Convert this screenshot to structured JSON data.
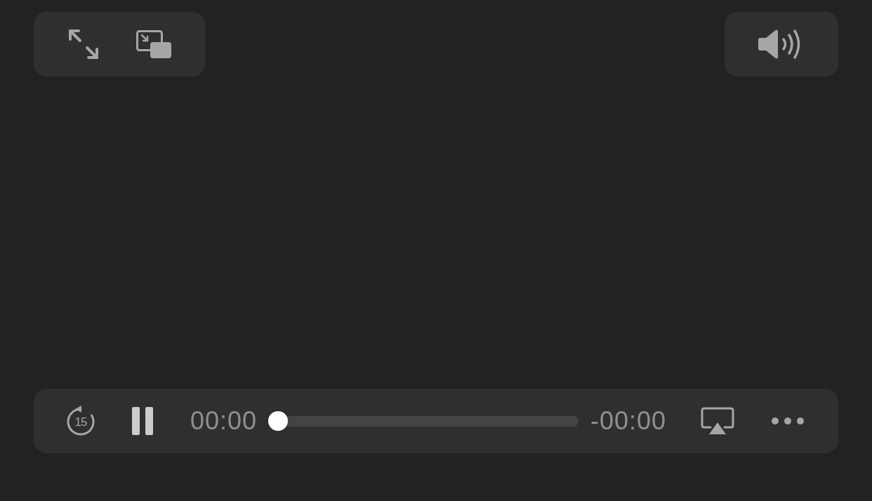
{
  "playback_bar": {
    "skip_back_label": "15",
    "playing": true,
    "elapsed": "00:00",
    "progress": {
      "level": 0
    },
    "remaining": "-00:00"
  }
}
